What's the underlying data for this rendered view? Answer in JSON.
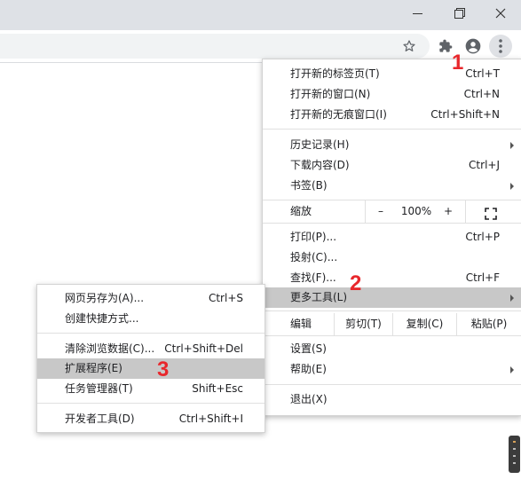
{
  "window": {
    "icons": [
      "minimize-icon",
      "restore-icon",
      "close-icon"
    ]
  },
  "toolbar": {
    "icons": [
      "star-icon",
      "extensions-icon",
      "profile-icon",
      "kebab-menu-icon"
    ]
  },
  "main_menu": {
    "new_tab": {
      "label": "打开新的标签页(T)",
      "shortcut": "Ctrl+T"
    },
    "new_window": {
      "label": "打开新的窗口(N)",
      "shortcut": "Ctrl+N"
    },
    "incognito": {
      "label": "打开新的无痕窗口(I)",
      "shortcut": "Ctrl+Shift+N"
    },
    "history": {
      "label": "历史记录(H)"
    },
    "downloads": {
      "label": "下载内容(D)",
      "shortcut": "Ctrl+J"
    },
    "bookmarks": {
      "label": "书签(B)"
    },
    "zoom": {
      "label": "缩放",
      "minus": "–",
      "value": "100%",
      "plus": "+"
    },
    "print": {
      "label": "打印(P)...",
      "shortcut": "Ctrl+P"
    },
    "cast": {
      "label": "投射(C)..."
    },
    "find": {
      "label": "查找(F)...",
      "shortcut": "Ctrl+F"
    },
    "more_tools": {
      "label": "更多工具(L)"
    },
    "edit": {
      "label": "编辑",
      "cut": "剪切(T)",
      "copy": "复制(C)",
      "paste": "粘贴(P)"
    },
    "settings": {
      "label": "设置(S)"
    },
    "help": {
      "label": "帮助(E)"
    },
    "exit": {
      "label": "退出(X)"
    }
  },
  "submenu": {
    "save_page": {
      "label": "网页另存为(A)...",
      "shortcut": "Ctrl+S"
    },
    "create_shortcut": {
      "label": "创建快捷方式..."
    },
    "clear_data": {
      "label": "清除浏览数据(C)...",
      "shortcut": "Ctrl+Shift+Del"
    },
    "extensions": {
      "label": "扩展程序(E)"
    },
    "task_manager": {
      "label": "任务管理器(T)",
      "shortcut": "Shift+Esc"
    },
    "dev_tools": {
      "label": "开发者工具(D)",
      "shortcut": "Ctrl+Shift+I"
    }
  },
  "annotations": {
    "step1": "1",
    "step2": "2",
    "step3": "3"
  },
  "colors": {
    "annotation": "#e8272c",
    "highlight": "#c8c8c8",
    "titlebar": "#dee1e6"
  }
}
